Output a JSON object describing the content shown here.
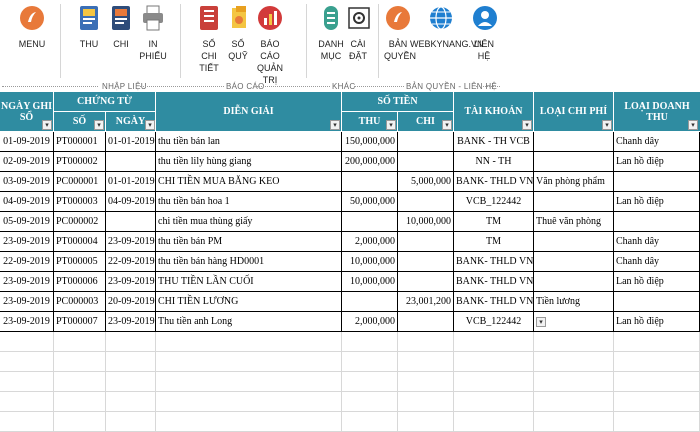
{
  "ribbon": {
    "buttons": [
      {
        "key": "menu",
        "label": "MENU",
        "icon": "menu-circle-icon"
      },
      {
        "key": "thu",
        "label": "THU",
        "icon": "receipt-icon"
      },
      {
        "key": "chi",
        "label": "CHI",
        "icon": "payment-icon"
      },
      {
        "key": "in_phieu",
        "label": "IN PHIẾU",
        "icon": "printer-icon"
      },
      {
        "key": "so_chi_tiet",
        "label": "SỔ CHI TIẾT",
        "icon": "ledger-icon"
      },
      {
        "key": "so_quy",
        "label": "SỔ QUỸ",
        "icon": "cash-book-icon"
      },
      {
        "key": "bao_cao",
        "label": "BÁO CÁO QUẢN TRỊ",
        "icon": "report-chart-icon"
      },
      {
        "key": "danh_muc",
        "label": "DANH MỤC",
        "icon": "list-icon"
      },
      {
        "key": "cai_dat",
        "label": "CÀI ĐẶT",
        "icon": "settings-icon"
      },
      {
        "key": "ban_quyen",
        "label": "BẢN QUYỀN",
        "icon": "license-icon"
      },
      {
        "key": "webkynang",
        "label": "WEBKYNANG.VN",
        "icon": "globe-icon"
      },
      {
        "key": "lien_he",
        "label": "LIÊN HỆ",
        "icon": "contact-icon"
      }
    ],
    "groups": {
      "nhap_lieu": "NHẬP LIỆU",
      "bao_cao": "BÁO CÁO",
      "khac": "KHÁC",
      "ban_quyen_lien_he": "BẢN QUYỀN - LIÊN HỆ"
    }
  },
  "columns": {
    "ngay_ghi_so": "NGÀY GHI SỔ",
    "chung_tu": "CHỨNG TỪ",
    "so": "SỐ",
    "ngay": "NGÀY",
    "dien_giai": "DIỄN GIẢI",
    "so_tien": "SỐ TIỀN",
    "thu": "THU",
    "chi": "CHI",
    "tai_khoan": "TÀI KHOẢN",
    "loai_chi_phi": "LOẠI CHI PHÍ",
    "loai_doanh_thu": "LOẠI DOANH THU"
  },
  "rows": [
    {
      "ngay_ghi": "01-09-2019",
      "so": "PT000001",
      "ngay": "01-01-2019",
      "dien_giai": "thu tiền bán lan",
      "thu": "150,000,000",
      "chi": "",
      "tai_khoan": "BANK - TH VCB",
      "loai_chi_phi": "",
      "loai_doanh_thu": "Chanh dây"
    },
    {
      "ngay_ghi": "02-09-2019",
      "so": "PT000002",
      "ngay": "",
      "dien_giai": "thu tiền lily hùng giang",
      "thu": "200,000,000",
      "chi": "",
      "tai_khoan": "NN - TH",
      "loai_chi_phi": "",
      "loai_doanh_thu": "Lan hồ điệp"
    },
    {
      "ngay_ghi": "03-09-2019",
      "so": "PC000001",
      "ngay": "01-01-2019",
      "dien_giai": "CHI TIỀN MUA BĂNG KEO",
      "thu": "",
      "chi": "5,000,000",
      "tai_khoan": "BANK- THLD VND",
      "loai_chi_phi": "Văn phòng phẩm",
      "loai_doanh_thu": ""
    },
    {
      "ngay_ghi": "04-09-2019",
      "so": "PT000003",
      "ngay": "04-09-2019",
      "dien_giai": "thu tiền bán hoa 1",
      "thu": "50,000,000",
      "chi": "",
      "tai_khoan": "VCB_122442",
      "loai_chi_phi": "",
      "loai_doanh_thu": "Lan hồ điệp"
    },
    {
      "ngay_ghi": "05-09-2019",
      "so": "PC000002",
      "ngay": "",
      "dien_giai": "chi tiền mua thùng giấy",
      "thu": "",
      "chi": "10,000,000",
      "tai_khoan": "TM",
      "loai_chi_phi": "Thuê văn phòng",
      "loai_doanh_thu": ""
    },
    {
      "ngay_ghi": "23-09-2019",
      "so": "PT000004",
      "ngay": "23-09-2019",
      "dien_giai": "thu tiền bán PM",
      "thu": "2,000,000",
      "chi": "",
      "tai_khoan": "TM",
      "loai_chi_phi": "",
      "loai_doanh_thu": "Chanh dây"
    },
    {
      "ngay_ghi": "22-09-2019",
      "so": "PT000005",
      "ngay": "22-09-2019",
      "dien_giai": "thu tiền bán hàng HD0001",
      "thu": "10,000,000",
      "chi": "",
      "tai_khoan": "BANK- THLD VND",
      "loai_chi_phi": "",
      "loai_doanh_thu": "Chanh dây"
    },
    {
      "ngay_ghi": "23-09-2019",
      "so": "PT000006",
      "ngay": "23-09-2019",
      "dien_giai": "THU TIỀN LẦN CUỐI",
      "thu": "10,000,000",
      "chi": "",
      "tai_khoan": "BANK- THLD VND",
      "loai_chi_phi": "",
      "loai_doanh_thu": "Lan hồ điệp"
    },
    {
      "ngay_ghi": "23-09-2019",
      "so": "PC000003",
      "ngay": "20-09-2019",
      "dien_giai": "CHI TIỀN LƯƠNG",
      "thu": "",
      "chi": "23,001,200",
      "tai_khoan": "BANK- THLD VND",
      "loai_chi_phi": "Tiền lương",
      "loai_doanh_thu": ""
    },
    {
      "ngay_ghi": "23-09-2019",
      "so": "PT000007",
      "ngay": "23-09-2019",
      "dien_giai": "Thu tiền anh Long",
      "thu": "2,000,000",
      "chi": "",
      "tai_khoan": "VCB_122442",
      "loai_chi_phi": "",
      "loai_doanh_thu": "Lan hồ điệp"
    }
  ],
  "colors": {
    "header": "#2f8ca1",
    "accent_orange": "#e8793a",
    "accent_blue": "#1f7fd0"
  }
}
